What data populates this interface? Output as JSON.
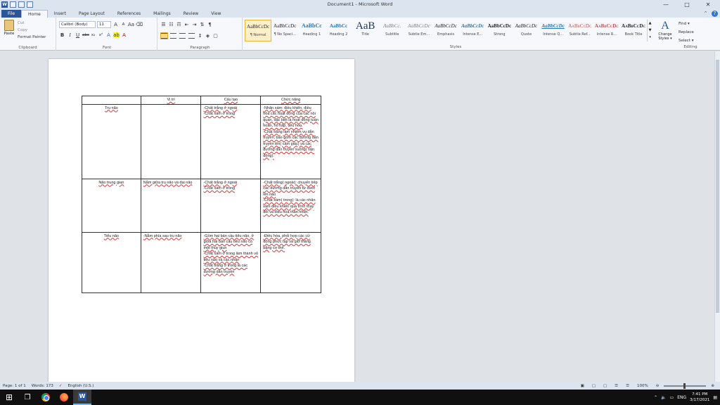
{
  "window": {
    "title": "Document1 - Microsoft Word",
    "app_icon": "W",
    "minimize": "—",
    "maximize": "□",
    "close": "✕"
  },
  "tabs": [
    "File",
    "Home",
    "Insert",
    "Page Layout",
    "References",
    "Mailings",
    "Review",
    "View"
  ],
  "clipboard": {
    "paste": "Paste",
    "cut": "Cut",
    "copy": "Copy",
    "format_painter": "Format Painter",
    "label": "Clipboard"
  },
  "font": {
    "family": "Calibri (Body)",
    "size": "11",
    "label": "Font"
  },
  "paragraph": {
    "label": "Paragraph"
  },
  "styles": {
    "label": "Styles",
    "items": [
      {
        "sample": "AaBbCcDc",
        "name": "¶ Normal"
      },
      {
        "sample": "AaBbCcDc",
        "name": "¶ No Spaci..."
      },
      {
        "sample": "AaBbCc",
        "name": "Heading 1"
      },
      {
        "sample": "AaBbCc",
        "name": "Heading 2"
      },
      {
        "sample": "AaB",
        "name": "Title"
      },
      {
        "sample": "AaBbCc.",
        "name": "Subtitle"
      },
      {
        "sample": "AaBbCcDc",
        "name": "Subtle Em..."
      },
      {
        "sample": "AaBbCcDc",
        "name": "Emphasis"
      },
      {
        "sample": "AaBbCcDc",
        "name": "Intense E..."
      },
      {
        "sample": "AaBbCcDc",
        "name": "Strong"
      },
      {
        "sample": "AaBbCcDc",
        "name": "Quote"
      },
      {
        "sample": "AaBbCcDc",
        "name": "Intense Q..."
      },
      {
        "sample": "AaBbCcDc",
        "name": "Subtle Ref..."
      },
      {
        "sample": "AaBbCcDc",
        "name": "Intense R..."
      },
      {
        "sample": "AaBbCcDc",
        "name": "Book Title"
      }
    ]
  },
  "change_styles": {
    "glyph": "A",
    "label": "Change Styles ▾"
  },
  "editing": {
    "find": "Find ▾",
    "replace": "Replace",
    "select": "Select ▾",
    "label": "Editing"
  },
  "table": {
    "headers": [
      "",
      "Vị trí",
      "Cấu tạo",
      "Chức năng"
    ],
    "rows": [
      {
        "name": "Trụ não",
        "position": "",
        "structure": "-Chất trắng ở ngoài\n-Chất xám ở trong",
        "function": "-Nhân xám: điều khiển, điều hòa các hoạt động của các nội quan, đặc biệt là hoạt động tuần hoàn, hô hấp, tiêu hóa.\n-Chất trắng làm nhiệm vụ dẫn truyền, bao gồm các đường dẫn truyền lên( cảm giác) và các đường dẫn truyền xuống( vận động)."
      },
      {
        "name": "Não trung gian",
        "position": "Nằm giữa trụ não và đại não",
        "structure": "-Chất trắng ở ngoài\n-Chất xám ở trong",
        "function": "-Chất trắng( ngoài): chuyển tiếp các đường dẫn truyền từ dưới lên não\n-Chất xám( trong): là các nhân xám điều khiển quá trình thay đổi và điều hòa thân nhiệt."
      },
      {
        "name": "Tiểu não",
        "position": "-Nằm phía sau trụ não",
        "structure": "-Gồm hai bán cầu tiểu não, ở giữa hai bán cầu tiểu não có một thùy giun\n-Chất xám ở trong làm thành vỏ tiểu não và các nhân\n-Chất trắng ở trong là các đường dẫn truyền",
        "function": "-Điều hòa, phối hợp các cử động phức tạp và giữ thăng bằng cơ thể."
      }
    ]
  },
  "status": {
    "page": "Page: 1 of 1",
    "words": "Words: 173",
    "language": "English (U.S.)",
    "zoom": "100%"
  },
  "taskbar": {
    "windows_icon": "⊞",
    "taskview_icon": "❐",
    "word_icon": "W",
    "tray_language": "ENG",
    "time": "7:41 PM",
    "date": "3/17/2021"
  }
}
